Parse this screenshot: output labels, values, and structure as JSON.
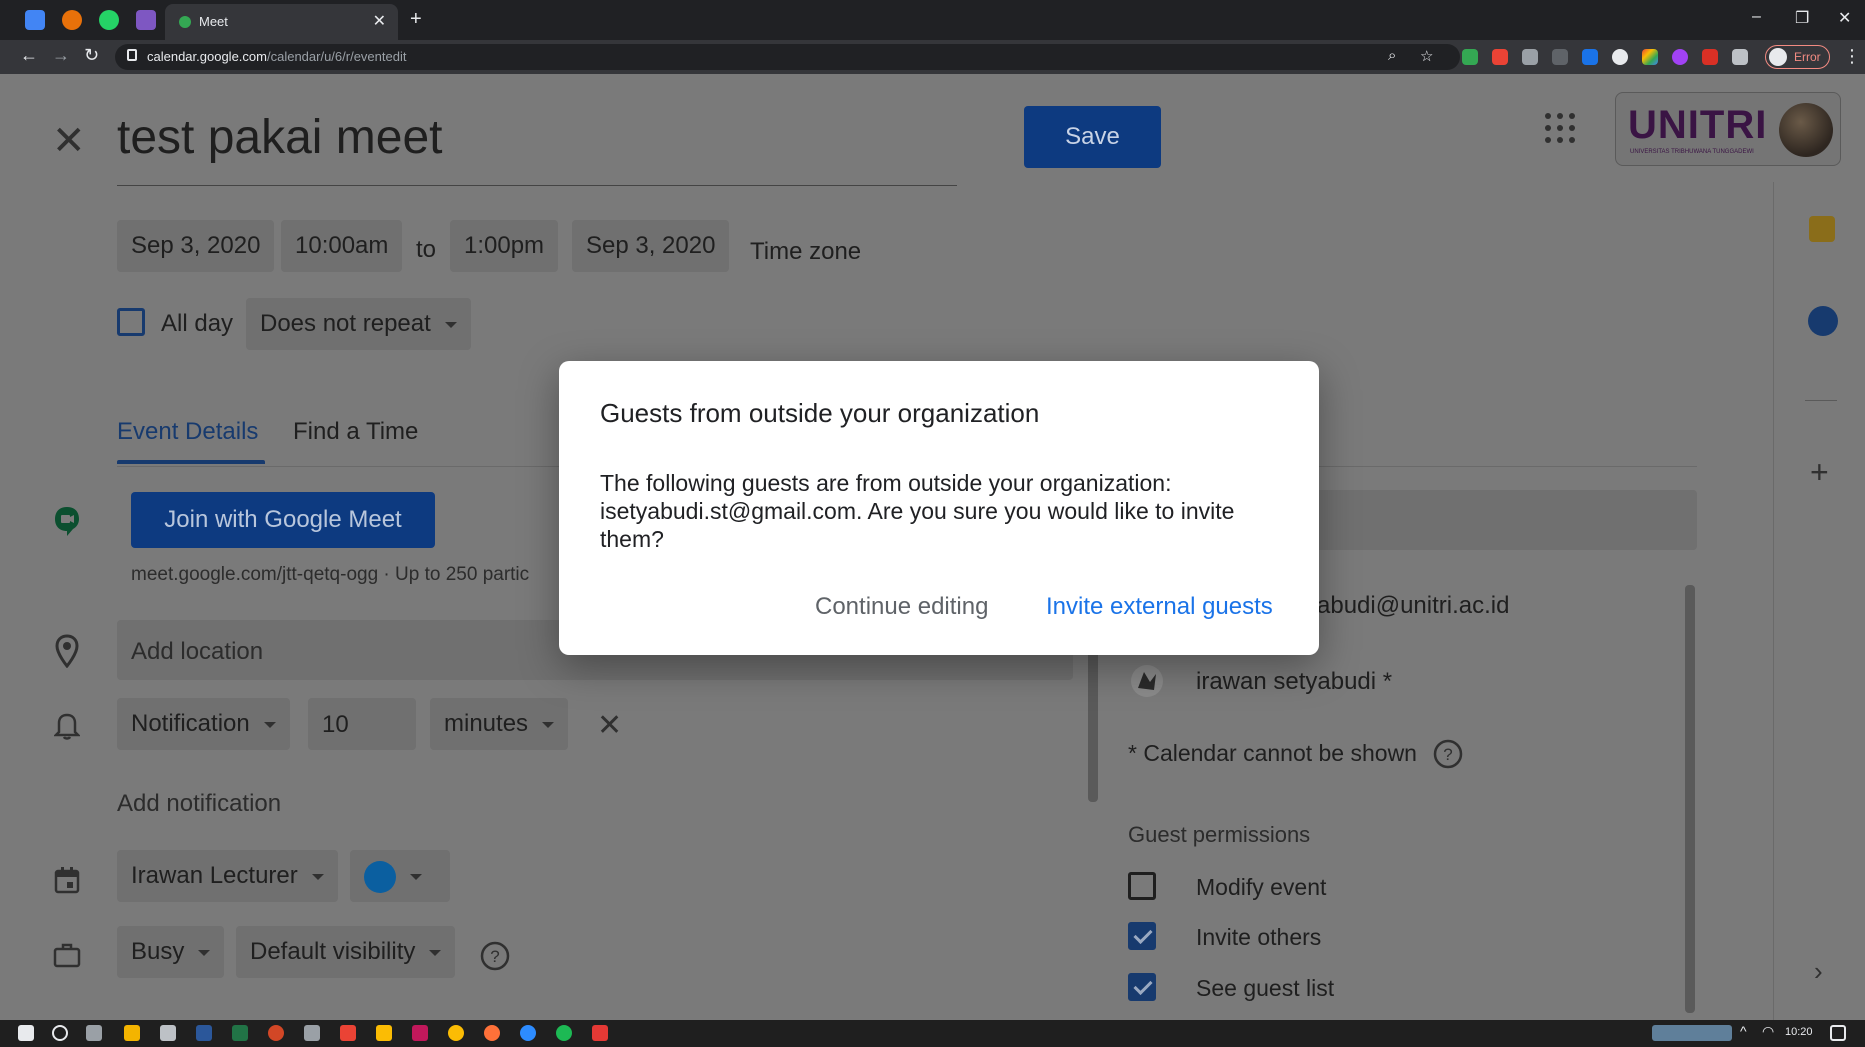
{
  "browser": {
    "tab_title": "Meet",
    "url_host": "calendar.google.com",
    "url_path": "/calendar/u/6/r/eventedit",
    "profile_status": "Error"
  },
  "event": {
    "title": "test pakai meet",
    "save_label": "Save",
    "start_date": "Sep 3, 2020",
    "start_time": "10:00am",
    "to_label": "to",
    "end_time": "1:00pm",
    "end_date": "Sep 3, 2020",
    "timezone_label": "Time zone",
    "all_day_label": "All day",
    "repeat": "Does not repeat"
  },
  "org": {
    "logo_text": "UNITRI",
    "logo_sub": "UNIVERSITAS TRIBHUWANA TUNGGADEWI"
  },
  "tabs": [
    {
      "label": "Event Details",
      "active": true
    },
    {
      "label": "Find a Time",
      "active": false
    }
  ],
  "meet": {
    "button_label": "Join with Google Meet",
    "link_text": "meet.google.com/jtt-qetq-ogg · Up to 250 partic"
  },
  "location": {
    "placeholder": "Add location"
  },
  "notification": {
    "type": "Notification",
    "amount": "10",
    "unit": "minutes",
    "add_label": "Add notification"
  },
  "calendar": {
    "owner": "Irawan Lecturer",
    "color": "#0b5fa0",
    "busy": "Busy",
    "visibility": "Default visibility"
  },
  "guests": {
    "email_partial": "abudi@unitri.ac.id",
    "guest_name": "irawan setyabudi *",
    "calendar_note": "* Calendar cannot be shown",
    "permissions_title": "Guest permissions",
    "permissions": [
      {
        "label": "Modify event",
        "checked": false
      },
      {
        "label": "Invite others",
        "checked": true
      },
      {
        "label": "See guest list",
        "checked": true
      }
    ]
  },
  "dialog": {
    "title": "Guests from outside your organization",
    "body": "The following guests are from outside your organization: isetyabudi.st@gmail.com. Are you sure you would like to invite them?",
    "secondary_label": "Continue editing",
    "primary_label": "Invite external guests"
  },
  "taskbar": {
    "time": "10:20"
  },
  "colors": {
    "accent": "#1a73e8",
    "save_bg": "#1a5bc4",
    "meet_green": "#0f9d58"
  }
}
